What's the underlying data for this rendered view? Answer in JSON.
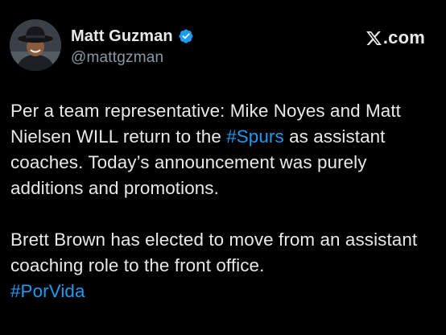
{
  "author": {
    "display_name": "Matt Guzman",
    "handle": "@mattgzman",
    "verified": true
  },
  "brand": {
    "suffix": ".com",
    "icon": "x-logo-icon"
  },
  "tweet": {
    "p1_a": "Per a team representative: Mike Noyes and Matt Nielsen WILL return to the ",
    "p1_tag": "#Spurs",
    "p1_b": " as assistant coaches. Today’s announcement was purely additions and promotions.",
    "p2_a": "Brett Brown has elected to move from an assistant coaching role to the front office.",
    "p2_tag": "#PorVida"
  },
  "colors": {
    "background": "#000000",
    "text": "#e7e9ea",
    "secondary_text": "#8b98a5",
    "link": "#1d9bf0",
    "verified_badge": "#1d9bf0"
  }
}
